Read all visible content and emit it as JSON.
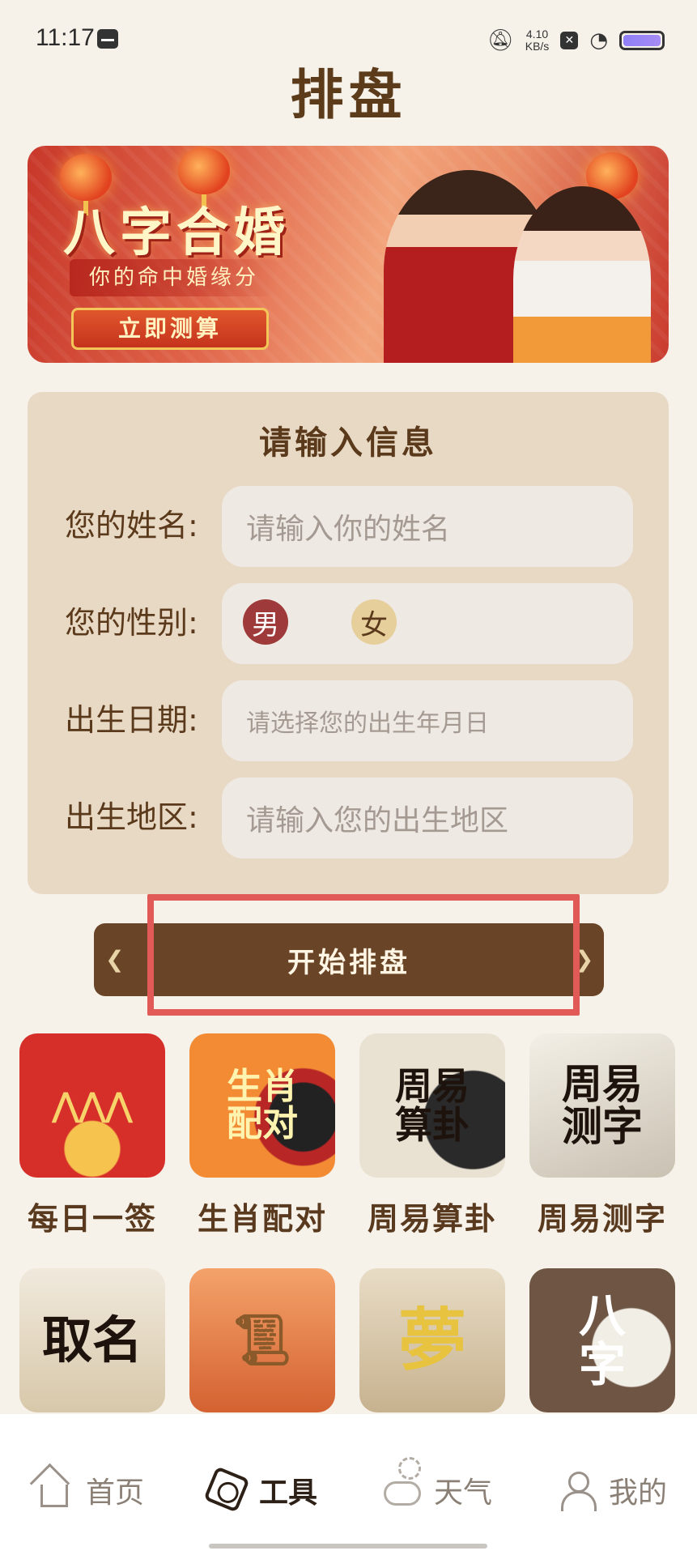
{
  "status_bar": {
    "time": "11:17",
    "net_speed_value": "4.10",
    "net_speed_unit": "KB/s",
    "notification_icon": "message-icon",
    "mute_icon": "bell-off-icon",
    "wifi_icon": "wifi-icon",
    "battery_icon": "battery-icon"
  },
  "page": {
    "title": "排盘"
  },
  "banner": {
    "title": "八字合婚",
    "subtitle": "你的命中婚缘分",
    "button": "立即测算"
  },
  "form": {
    "title": "请输入信息",
    "name_label": "您的姓名:",
    "name_placeholder": "请输入你的姓名",
    "gender_label": "您的性别:",
    "gender_male": "男",
    "gender_female": "女",
    "selected_gender": "男",
    "date_label": "出生日期:",
    "date_placeholder": "请选择您的出生年月日",
    "region_label": "出生地区:",
    "region_placeholder": "请输入您的出生地区"
  },
  "start_button": {
    "label": "开始排盘"
  },
  "tools": [
    {
      "label": "每日一签",
      "image_text": ""
    },
    {
      "label": "生肖配对",
      "image_text": "生肖配对"
    },
    {
      "label": "周易算卦",
      "image_text": "周易算卦"
    },
    {
      "label": "周易测字",
      "image_text": "周易测字"
    },
    {
      "label": "",
      "image_text": "取名"
    },
    {
      "label": "",
      "image_text": ""
    },
    {
      "label": "",
      "image_text": "夢"
    },
    {
      "label": "",
      "image_text": "八字"
    }
  ],
  "bottom_nav": [
    {
      "label": "首页",
      "icon": "home-icon",
      "active": false
    },
    {
      "label": "工具",
      "icon": "bagua-icon",
      "active": true
    },
    {
      "label": "天气",
      "icon": "weather-icon",
      "active": false
    },
    {
      "label": "我的",
      "icon": "profile-icon",
      "active": false
    }
  ],
  "colors": {
    "background": "#f6f2ea",
    "card": "#e8d9c5",
    "primary_brown": "#6a4426",
    "male": "#9e3a3a",
    "female": "#e7cf9c",
    "highlight": "#e25a58"
  }
}
